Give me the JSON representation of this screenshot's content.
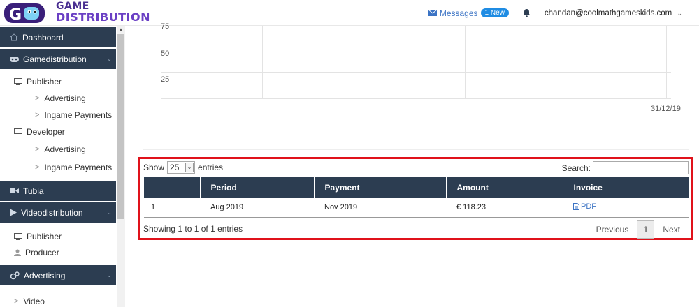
{
  "header": {
    "logo_line1": "GAME",
    "logo_line2": "DISTRIBUTION",
    "messages_label": "Messages",
    "messages_badge": "1 New",
    "user_email": "chandan@coolmathgameskids.com"
  },
  "sidebar": {
    "items": [
      {
        "label": "Dashboard",
        "icon": "home-icon",
        "style": "dark"
      },
      {
        "label": "Gamedistribution",
        "icon": "gamepad-icon",
        "style": "dark",
        "expanded": true
      },
      {
        "label": "Publisher",
        "icon": "monitor-icon",
        "style": "light-1"
      },
      {
        "label": "Advertising",
        "style": "light-2"
      },
      {
        "label": "Ingame Payments",
        "style": "light-2"
      },
      {
        "label": "Developer",
        "icon": "monitor-icon",
        "style": "light-1"
      },
      {
        "label": "Advertising",
        "style": "light-2"
      },
      {
        "label": "Ingame Payments",
        "style": "light-2"
      },
      {
        "label": "Tubia",
        "icon": "video-camera-icon",
        "style": "dark"
      },
      {
        "label": "Videodistribution",
        "icon": "play-icon",
        "style": "dark",
        "expanded": true
      },
      {
        "label": "Publisher",
        "icon": "monitor-icon",
        "style": "light-1"
      },
      {
        "label": "Producer",
        "icon": "user-icon",
        "style": "light-1"
      },
      {
        "label": "Advertising",
        "icon": "cogs-icon",
        "style": "dark",
        "expanded": true
      },
      {
        "label": "Video",
        "style": "light-1-gt"
      }
    ]
  },
  "chart_data": {
    "type": "line",
    "y_ticks": [
      "75",
      "50",
      "25"
    ],
    "x_tick": "31/12/19",
    "grid": true,
    "series": []
  },
  "table": {
    "show_label": "Show",
    "length_value": "25",
    "entries_label": "entries",
    "search_label": "Search:",
    "search_value": "",
    "columns": [
      "",
      "Period",
      "Payment",
      "Amount",
      "Invoice"
    ],
    "rows": [
      {
        "index": "1",
        "period": "Aug 2019",
        "payment": "Nov 2019",
        "amount": "€ 118.23",
        "invoice": "PDF"
      }
    ],
    "info": "Showing 1 to 1 of 1 entries",
    "prev_label": "Previous",
    "page": "1",
    "next_label": "Next"
  },
  "colors": {
    "sidebar_dark": "#2c3d51",
    "table_header": "#2c3d51",
    "highlight": "#e0121b",
    "link": "#3b73c4",
    "badge": "#1f8ce3"
  }
}
